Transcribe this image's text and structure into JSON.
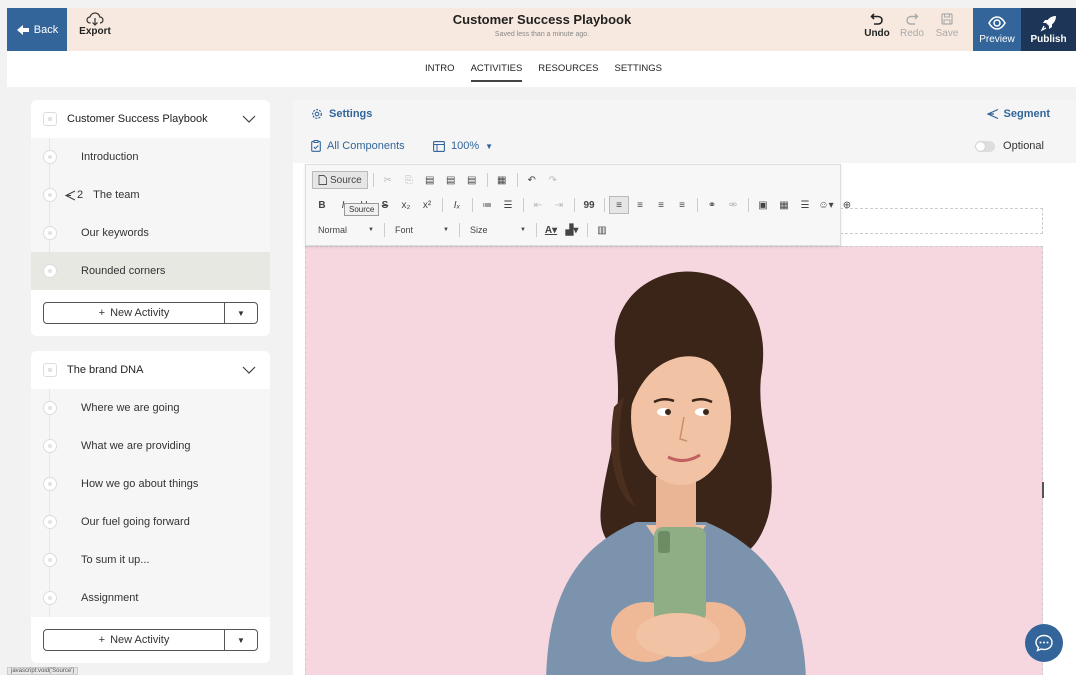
{
  "topbar": {
    "back_label": "Back",
    "export_label": "Export",
    "title": "Customer Success Playbook",
    "subtitle": "Saved less than a minute ago.",
    "undo_label": "Undo",
    "redo_label": "Redo",
    "save_label": "Save",
    "preview_label": "Preview",
    "publish_label": "Publish"
  },
  "tabs": [
    "INTRO",
    "ACTIVITIES",
    "RESOURCES",
    "SETTINGS"
  ],
  "sidebar": {
    "group1": {
      "title": "Customer Success Playbook",
      "items": [
        {
          "label": "Introduction"
        },
        {
          "label": "The team",
          "segment": "2"
        },
        {
          "label": "Our keywords"
        },
        {
          "label": "Rounded corners"
        }
      ],
      "new_activity": "New Activity"
    },
    "group2": {
      "title": "The brand DNA",
      "items": [
        {
          "label": "Where we are going"
        },
        {
          "label": "What we are providing"
        },
        {
          "label": "How we go about things"
        },
        {
          "label": "Our fuel going forward"
        },
        {
          "label": "To sum it up..."
        },
        {
          "label": "Assignment"
        }
      ],
      "new_activity": "New Activity"
    }
  },
  "main": {
    "settings_label": "Settings",
    "segment_label": "Segment",
    "all_components_label": "All Components",
    "zoom_label": "100%",
    "optional_label": "Optional"
  },
  "editor_toolbar": {
    "source_label": "Source",
    "tooltip": "Source",
    "format_value": "Normal",
    "font_value": "Font",
    "size_value": "Size"
  },
  "statusbar": "javascript:void('Source')",
  "colors": {
    "primary": "#33659a",
    "publish": "#1d3557",
    "topbar_bg": "#f7e9df",
    "image_bg": "#f6d7e0"
  }
}
